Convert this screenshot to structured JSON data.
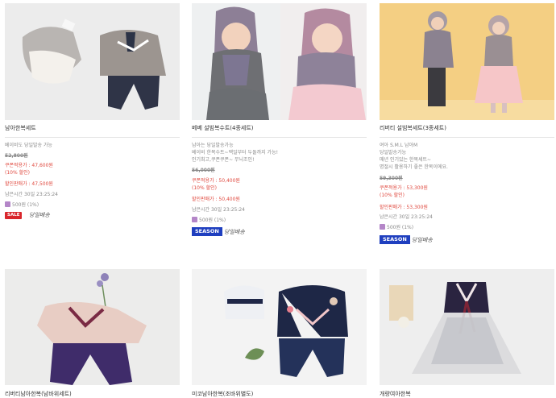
{
  "colors": {
    "accent_red": "#e0493f",
    "sale_badge": "#d9262c",
    "season_badge": "#1f3fbf",
    "point_icon": "#b486c8"
  },
  "products": [
    {
      "name": "남아한복세트",
      "desc1": "베이비도 당일발송 가능",
      "list_price": "52,800원",
      "coupon_price": "쿠폰적용가 : 47,600원",
      "coupon_pct": "(10% 할인)",
      "sale_price": "할인판매가 : 47,500원",
      "time_left": "남은시간 30일 23:25:24",
      "points": "500원 (1%)",
      "badge": "SALE",
      "brand": "당일배송"
    },
    {
      "name": "베베 설빔복수트(4종세트)",
      "desc1": "남아는 당일발송가능",
      "desc2": "베이비 한복수트~백일부터 두돌까지 가능!",
      "desc3": "인기최고,쿠폰쿠폰~ 무늬조인!",
      "list_price": "56,000원",
      "coupon_price": "쿠폰적용가 : 50,400원",
      "coupon_pct": "(10% 할인)",
      "sale_price": "할인판매가 : 50,400원",
      "time_left": "남은시간 30일 23:25:24",
      "points": "500원 (1%)",
      "badge": "SEASON",
      "brand": "당일배송"
    },
    {
      "name": "리버티 설빔복세트(3종세트)",
      "desc1": "여아 S.M.L 남아M",
      "desc2": "당일발송가능",
      "desc3": "매년 인기있는 한복세트~",
      "desc4": "명절시 활용하기 좋은 한복이에요.",
      "list_price": "59,300원",
      "coupon_price": "쿠폰적용가 : 53,300원",
      "coupon_pct": "(10% 할인)",
      "sale_price": "할인판매가 : 53,300원",
      "time_left": "남은시간 30일 23:25:24",
      "points": "500원 (1%)",
      "badge": "SEASON",
      "brand": "당일배송"
    },
    {
      "name": "리버티남아한복(남바위세트)"
    },
    {
      "name": "미코남아한복(조바위별도)"
    },
    {
      "name": "개량여아한복"
    }
  ]
}
